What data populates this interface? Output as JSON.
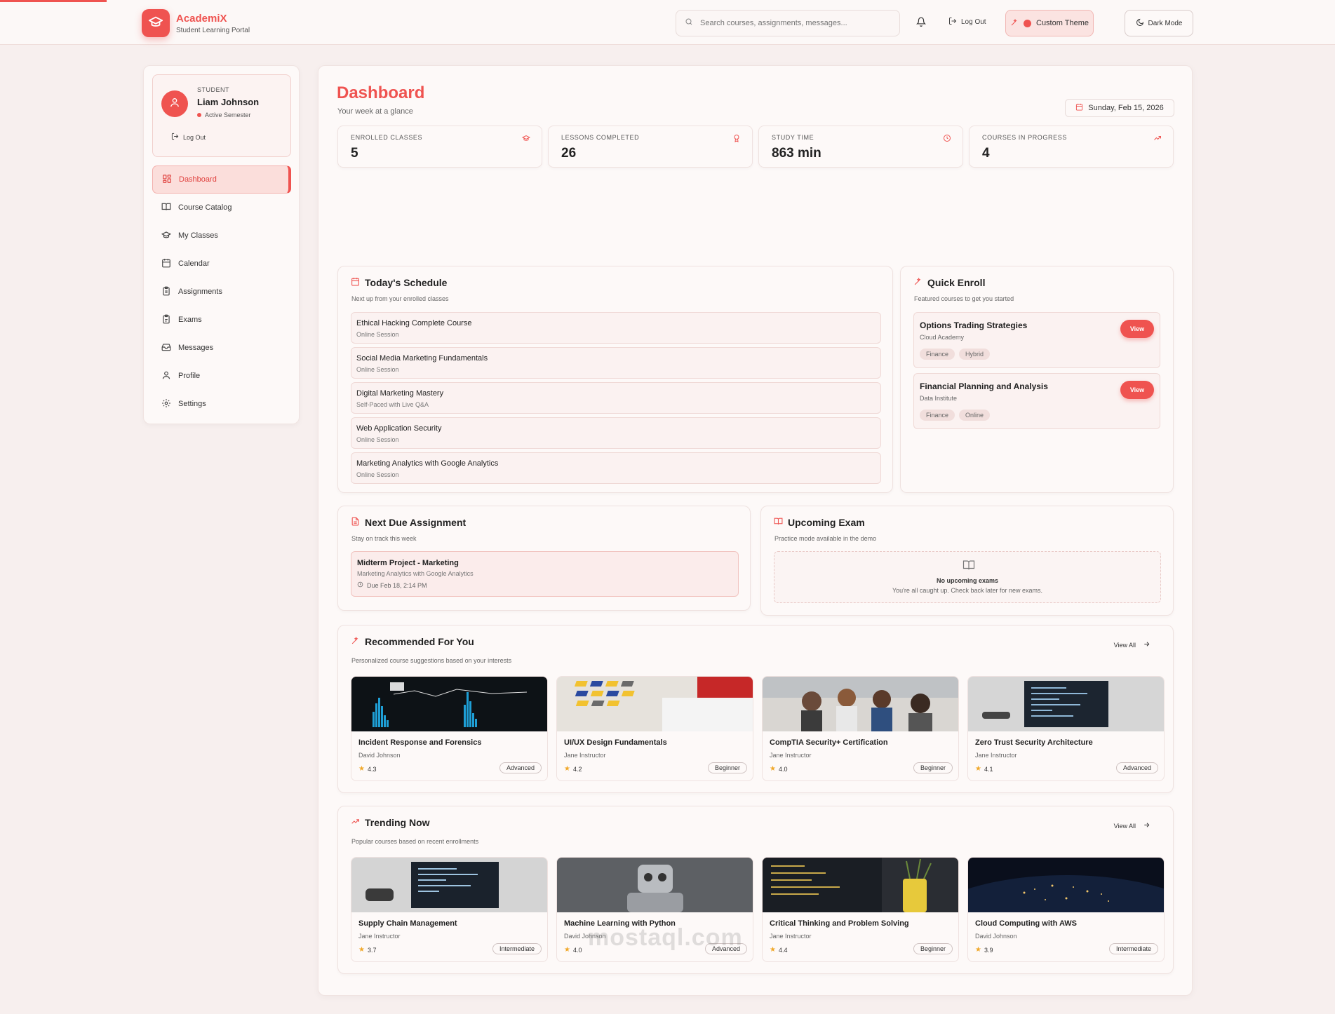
{
  "app": {
    "name": "AcademiX",
    "subtitle": "Student Learning Portal",
    "accent": "#ef5350"
  },
  "header": {
    "search_placeholder": "Search courses, assignments, messages...",
    "logout_label": "Log Out",
    "custom_theme_label": "Custom Theme",
    "dark_mode_label": "Dark Mode"
  },
  "user": {
    "role": "STUDENT",
    "name": "Liam Johnson",
    "status": "Active Semester",
    "logout_label": "Log Out"
  },
  "sidebar": {
    "items": [
      {
        "label": "Dashboard",
        "icon": "grid-icon",
        "active": true
      },
      {
        "label": "Course Catalog",
        "icon": "book-icon"
      },
      {
        "label": "My Classes",
        "icon": "graduation-cap-icon"
      },
      {
        "label": "Calendar",
        "icon": "calendar-icon"
      },
      {
        "label": "Assignments",
        "icon": "clipboard-icon"
      },
      {
        "label": "Exams",
        "icon": "clipboard-check-icon"
      },
      {
        "label": "Messages",
        "icon": "inbox-icon"
      },
      {
        "label": "Profile",
        "icon": "user-icon"
      },
      {
        "label": "Settings",
        "icon": "gear-icon"
      }
    ]
  },
  "dashboard": {
    "title": "Dashboard",
    "subtitle": "Your week at a glance",
    "date": "Sunday, Feb 15, 2026"
  },
  "stats": [
    {
      "label": "ENROLLED CLASSES",
      "value": "5",
      "icon": "graduation-cap-icon"
    },
    {
      "label": "LESSONS COMPLETED",
      "value": "26",
      "icon": "award-icon"
    },
    {
      "label": "STUDY TIME",
      "value": "863 min",
      "icon": "clock-icon"
    },
    {
      "label": "COURSES IN PROGRESS",
      "value": "4",
      "icon": "trending-up-icon"
    }
  ],
  "schedule": {
    "title": "Today's Schedule",
    "subtitle": "Next up from your enrolled classes",
    "items": [
      {
        "title": "Ethical Hacking Complete Course",
        "mode": "Online Session"
      },
      {
        "title": "Social Media Marketing Fundamentals",
        "mode": "Online Session"
      },
      {
        "title": "Digital Marketing Mastery",
        "mode": "Self-Paced with Live Q&A"
      },
      {
        "title": "Web Application Security",
        "mode": "Online Session"
      },
      {
        "title": "Marketing Analytics with Google Analytics",
        "mode": "Online Session"
      }
    ]
  },
  "quick_enroll": {
    "title": "Quick Enroll",
    "subtitle": "Featured courses to get you started",
    "items": [
      {
        "title": "Options Trading Strategies",
        "provider": "Cloud Academy",
        "tags": [
          "Finance",
          "Hybrid"
        ],
        "button": "View"
      },
      {
        "title": "Financial Planning and Analysis",
        "provider": "Data Institute",
        "tags": [
          "Finance",
          "Online"
        ],
        "button": "View"
      }
    ]
  },
  "assignment": {
    "title": "Next Due Assignment",
    "subtitle": "Stay on track this week",
    "item_title": "Midterm Project - Marketing",
    "item_course": "Marketing Analytics with Google Analytics",
    "item_due": "Due Feb 18, 2:14 PM"
  },
  "exam": {
    "title": "Upcoming Exam",
    "subtitle": "Practice mode available in the demo",
    "empty_title": "No upcoming exams",
    "empty_text": "You're all caught up. Check back later for new exams."
  },
  "recommended": {
    "title": "Recommended For You",
    "subtitle": "Personalized course suggestions based on your interests",
    "view_all": "View All",
    "courses": [
      {
        "title": "Incident Response and Forensics",
        "author": "David Johnson",
        "rating": "4.3",
        "level": "Advanced"
      },
      {
        "title": "UI/UX Design Fundamentals",
        "author": "Jane Instructor",
        "rating": "4.2",
        "level": "Beginner"
      },
      {
        "title": "CompTIA Security+ Certification",
        "author": "Jane Instructor",
        "rating": "4.0",
        "level": "Beginner"
      },
      {
        "title": "Zero Trust Security Architecture",
        "author": "Jane Instructor",
        "rating": "4.1",
        "level": "Advanced"
      }
    ]
  },
  "trending": {
    "title": "Trending Now",
    "subtitle": "Popular courses based on recent enrollments",
    "view_all": "View All",
    "courses": [
      {
        "title": "Supply Chain Management",
        "author": "Jane Instructor",
        "rating": "3.7",
        "level": "Intermediate"
      },
      {
        "title": "Machine Learning with Python",
        "author": "David Johnson",
        "rating": "4.0",
        "level": "Advanced"
      },
      {
        "title": "Critical Thinking and Problem Solving",
        "author": "Jane Instructor",
        "rating": "4.4",
        "level": "Beginner"
      },
      {
        "title": "Cloud Computing with AWS",
        "author": "David Johnson",
        "rating": "3.9",
        "level": "Intermediate"
      }
    ]
  },
  "watermark": "mostaql.com"
}
